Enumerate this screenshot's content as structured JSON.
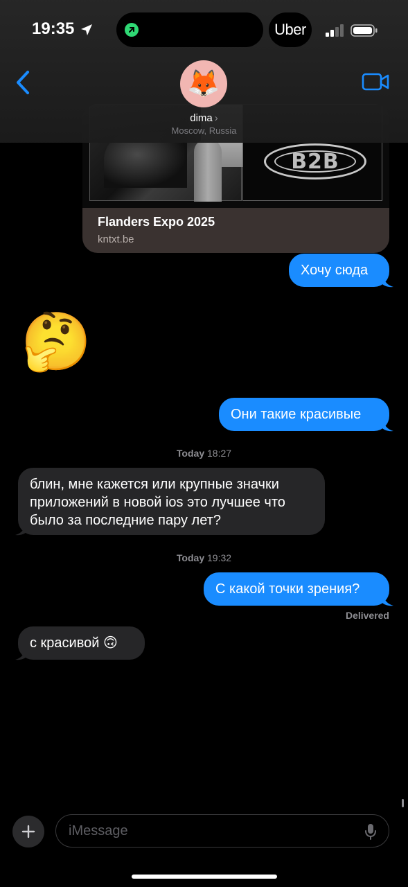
{
  "status_bar": {
    "time": "19:35",
    "live_activity_app": "Uber",
    "island_activity_color": "#2fd874"
  },
  "header": {
    "contact_name": "dima",
    "contact_location": "Moscow, Russia",
    "avatar_emoji": "🦊",
    "avatar_bg": "#f1b6b2",
    "accent": "#1a8cff"
  },
  "link_preview": {
    "image_text": "B2B",
    "title": "Flanders Expo 2025",
    "domain": "kntxt.be"
  },
  "messages": [
    {
      "dir": "out",
      "text": "Хочу сюда"
    },
    {
      "dir": "in",
      "text": "🤔",
      "kind": "emoji"
    },
    {
      "dir": "out",
      "text": "Они такие красивые"
    },
    {
      "kind": "timestamp",
      "day": "Today",
      "time": "18:27"
    },
    {
      "dir": "in",
      "lines": [
        "блин, мне кажется или крупные значки",
        "приложений в новой ios это лучшее что",
        "было за последние пару лет?"
      ]
    },
    {
      "kind": "timestamp",
      "day": "Today",
      "time": "19:32"
    },
    {
      "dir": "out",
      "text": "С какой точки зрения?"
    },
    {
      "kind": "status",
      "text": "Delivered"
    },
    {
      "dir": "in",
      "text": "с красивой 🙃"
    }
  ],
  "compose": {
    "placeholder": "iMessage"
  },
  "colors": {
    "outgoing_bubble": "#1a8cff",
    "incoming_bubble": "#262628",
    "background": "#000000"
  }
}
